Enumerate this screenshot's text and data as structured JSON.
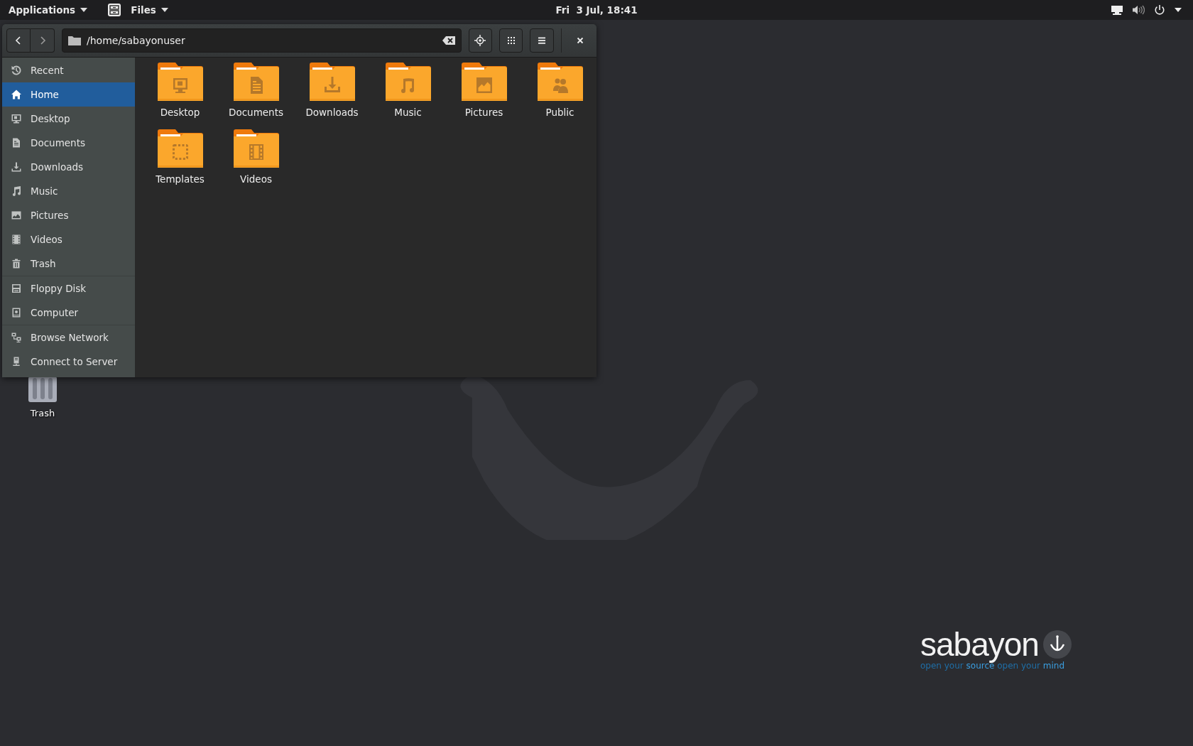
{
  "top_bar": {
    "applications_menu": "Applications",
    "app_menu": "Files",
    "clock": "Fri  3 Jul, 18:41"
  },
  "window": {
    "location": "/home/sabayonuser"
  },
  "sidebar": {
    "sections": [
      [
        {
          "label": "Recent",
          "selected": false
        },
        {
          "label": "Home",
          "selected": true
        },
        {
          "label": "Desktop",
          "selected": false
        },
        {
          "label": "Documents",
          "selected": false
        },
        {
          "label": "Downloads",
          "selected": false
        },
        {
          "label": "Music",
          "selected": false
        },
        {
          "label": "Pictures",
          "selected": false
        },
        {
          "label": "Videos",
          "selected": false
        },
        {
          "label": "Trash",
          "selected": false
        }
      ],
      [
        {
          "label": "Floppy Disk",
          "selected": false
        },
        {
          "label": "Computer",
          "selected": false
        }
      ],
      [
        {
          "label": "Browse Network",
          "selected": false
        },
        {
          "label": "Connect to Server",
          "selected": false
        }
      ]
    ]
  },
  "folders": [
    {
      "name": "Desktop"
    },
    {
      "name": "Documents"
    },
    {
      "name": "Downloads"
    },
    {
      "name": "Music"
    },
    {
      "name": "Pictures"
    },
    {
      "name": "Public"
    },
    {
      "name": "Templates"
    },
    {
      "name": "Videos"
    }
  ],
  "desktop": {
    "icons": [
      {
        "label": "Trash"
      }
    ],
    "logo": {
      "name": "sabayon",
      "tagline": "open your **source** open your **mind**"
    }
  }
}
